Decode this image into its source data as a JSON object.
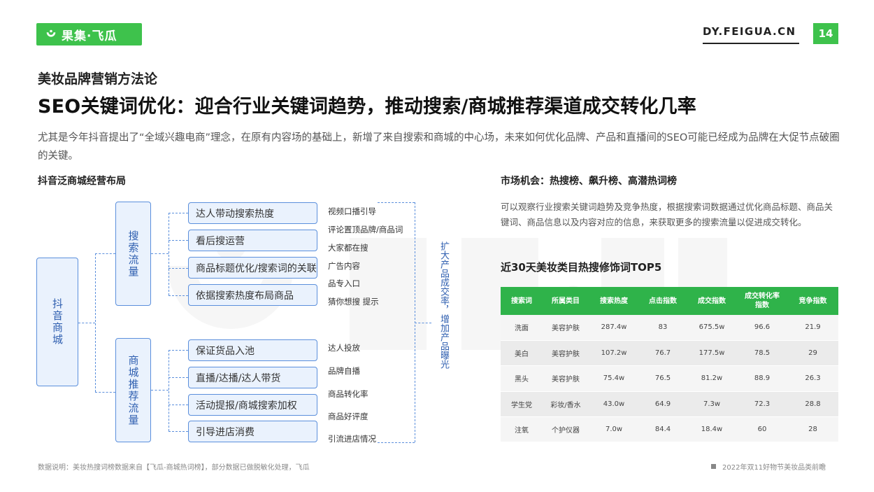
{
  "header": {
    "logo_text": "果集·飞瓜",
    "site_url": "DY.FEIGUA.CN",
    "page_number": "14"
  },
  "subtitle": "美妆品牌营销方法论",
  "title": "SEO关键词优化：迎合行业关键词趋势，推动搜索/商城推荐渠道成交转化几率",
  "intro": "尤其是今年抖音提出了“全域兴趣电商”理念，在原有内容场的基础上，新增了来自搜索和商城的中心场，未来如何优化品牌、产品和直播间的SEO可能已经成为品牌在大促节点破圈的关键。",
  "left_section": {
    "heading": "抖音泛商城经营布局",
    "root": "抖音商城",
    "groups": [
      {
        "name": "搜索流量",
        "items": [
          "达人带动搜索热度",
          "看后搜运营",
          "商品标题优化/搜索词的关联",
          "依据搜索热度布局商品"
        ]
      },
      {
        "name": "商城推荐流量",
        "items": [
          "保证货品入池",
          "直播/达播/达人带货",
          "活动提报/商城搜索加权",
          "引导进店消费"
        ]
      }
    ],
    "side_labels": [
      "视频口播引导",
      "评论置顶品牌/商品词",
      "大家都在搜",
      "广告内容",
      "品专入口",
      "猜你想搜 提示",
      "达人投放",
      "品牌自播",
      "商品转化率",
      "商品好评度",
      "引流进店情况"
    ],
    "vertical_note": "扩大产品成交率，增加产品曝光"
  },
  "right_section": {
    "heading": "市场机会：热搜榜、飙升榜、高潜热词榜",
    "description": "可以观察行业搜索关键词趋势及竞争热度，根据搜索词数据通过优化商品标题、商品关键词、商品信息以及内容对应的信息，来获取更多的搜索流量以促进成交转化。",
    "table_title": "近30天美妆类目热搜修饰词TOP5",
    "table": {
      "headers": [
        "搜索词",
        "所属类目",
        "搜索热度",
        "点击指数",
        "成交指数",
        "成交转化率指数",
        "竞争指数"
      ],
      "rows": [
        [
          "洗面",
          "美容护肤",
          "287.4w",
          "83",
          "675.5w",
          "96.6",
          "21.9"
        ],
        [
          "美白",
          "美容护肤",
          "107.2w",
          "76.7",
          "177.5w",
          "78.5",
          "29"
        ],
        [
          "黑头",
          "美容护肤",
          "75.4w",
          "76.5",
          "81.2w",
          "88.9",
          "26.3"
        ],
        [
          "学生党",
          "彩妆/香水",
          "43.0w",
          "64.9",
          "7.3w",
          "72.3",
          "28.8"
        ],
        [
          "注氧",
          "个护仪器",
          "7.0w",
          "84.4",
          "18.4w",
          "60",
          "28"
        ]
      ]
    }
  },
  "footer": {
    "note": "数据说明：美妆热搜词榜数据来自【飞瓜-商城热词榜】，部分数据已做脱敏化处理，飞瓜",
    "report_name": "2022年双11好物节美妆品类前瞻"
  },
  "colors": {
    "brand_green": "#3ec24c",
    "table_header_green": "#2fb34a",
    "diagram_blue": "#5b8fdc",
    "diagram_fill": "#eaf2fd"
  },
  "icons": {
    "logo": "feigua-logo-icon",
    "footer_marker": "square-bullet-icon"
  }
}
